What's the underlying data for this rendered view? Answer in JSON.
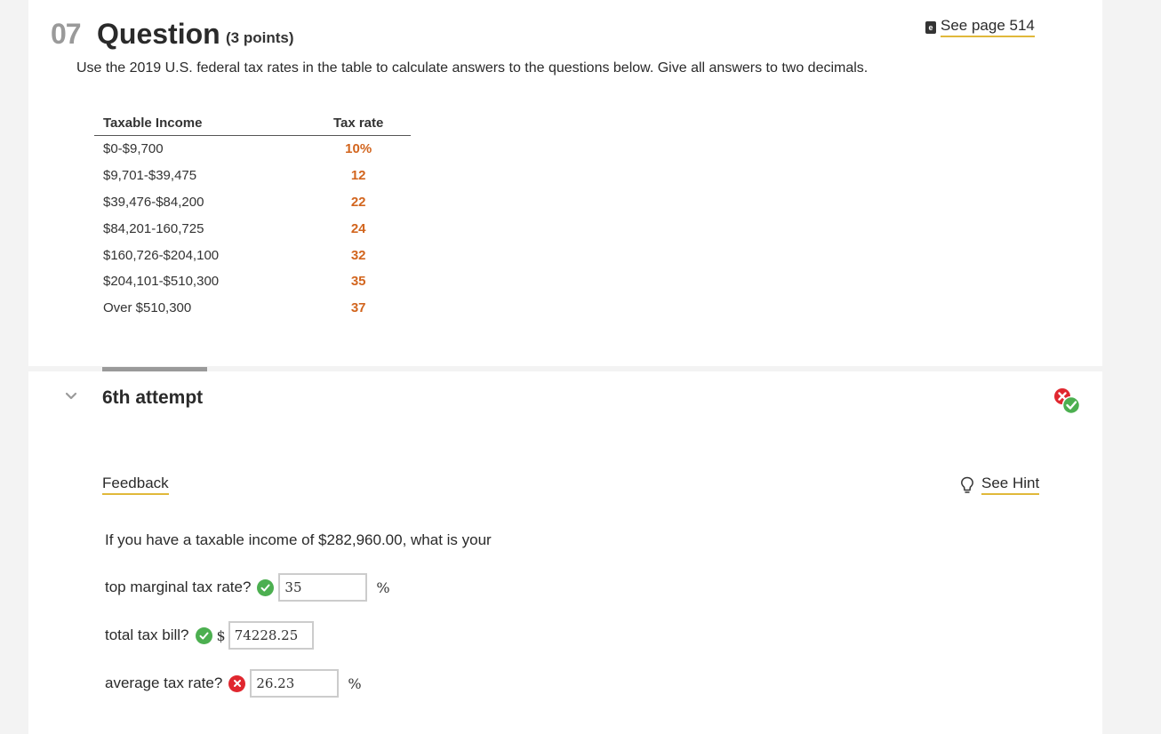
{
  "question": {
    "number": "07",
    "title": "Question",
    "points": "(3 points)",
    "reference_link": "See page 514",
    "reference_icon": "ebook-icon",
    "instructions": "Use the 2019 U.S. federal tax rates in the table to calculate answers to the questions below. Give all answers to two decimals."
  },
  "tax_table": {
    "headers": [
      "Taxable Income",
      "Tax rate"
    ],
    "rows": [
      {
        "income": "$0-$9,700",
        "rate": "10%"
      },
      {
        "income": "$9,701-$39,475",
        "rate": "12"
      },
      {
        "income": "$39,476-$84,200",
        "rate": "22"
      },
      {
        "income": "$84,201-160,725",
        "rate": "24"
      },
      {
        "income": "$160,726-$204,100",
        "rate": "32"
      },
      {
        "income": "$204,101-$510,300",
        "rate": "35"
      },
      {
        "income": "Over $510,300",
        "rate": "37"
      }
    ]
  },
  "attempt": {
    "label": "6th attempt",
    "status_icon": "mixed-result-icon",
    "feedback_link": "Feedback",
    "hint_link": "See Hint"
  },
  "problem": {
    "prompt": "If you have a taxable income of $282,960.00, what is your",
    "items": [
      {
        "label": "top marginal tax rate?",
        "status": "correct",
        "prefix": "",
        "value": "35",
        "suffix": "%"
      },
      {
        "label": "total tax bill?",
        "status": "correct",
        "prefix": "$",
        "value": "74228.25",
        "suffix": ""
      },
      {
        "label": "average tax rate?",
        "status": "incorrect",
        "prefix": "",
        "value": "26.23",
        "suffix": "%"
      }
    ]
  },
  "colors": {
    "rate_text": "#d2651e",
    "correct": "#4caf50",
    "incorrect": "#e0272f",
    "link_underline": "#e0b83a"
  }
}
